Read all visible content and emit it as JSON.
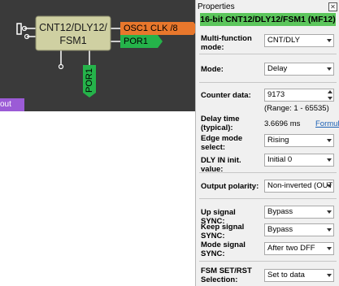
{
  "canvas": {
    "block_label_line1": "CNT12/DLY12/",
    "block_label_line2": "FSM1",
    "osc_tag": "OSC1 CLK /8",
    "por_tag": "POR1",
    "por_vertical_tag": "POR1",
    "out_tag": "out",
    "colors": {
      "background": "#3a3a3a",
      "block": "#cfd0a2",
      "osc_tag": "#e8772c",
      "por_tag": "#25b34a",
      "out_tag": "#9b5bd6"
    }
  },
  "panel": {
    "title": "Properties",
    "header": "16-bit CNT12/DLY12/FSM1 (MF12)",
    "header_color": "#5cc65c",
    "multi_function_label": "Multi-function mode:",
    "multi_function_value": "CNT/DLY",
    "mode_label": "Mode:",
    "mode_value": "Delay",
    "counter_label": "Counter data:",
    "counter_value": "9173",
    "counter_range": "(Range:  1 - 65535)",
    "delay_label": "Delay time (typical):",
    "delay_value": "3.6696 ms",
    "formula_link": "Formul",
    "edge_label": "Edge mode select:",
    "edge_value": "Rising",
    "dly_in_label": "DLY IN init. value:",
    "dly_in_value": "Initial 0",
    "output_pol_label": "Output polarity:",
    "output_pol_value": "Non-inverted (OUT",
    "up_sync_label": "Up signal SYNC:",
    "up_sync_value": "Bypass",
    "keep_sync_label": "Keep signal SYNC:",
    "keep_sync_value": "Bypass",
    "mode_sync_label": "Mode signal SYNC:",
    "mode_sync_value": "After two DFF",
    "fsm_label": "FSM SET/RST Selection:",
    "fsm_value": "Set to data"
  }
}
